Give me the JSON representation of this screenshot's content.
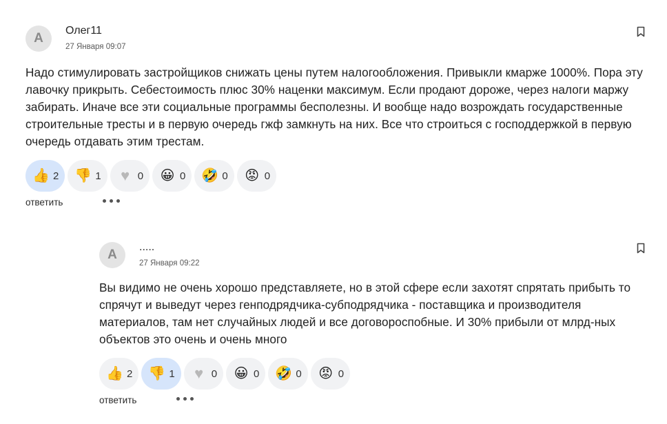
{
  "comments": [
    {
      "avatar_letter": "A",
      "author": "Олег11",
      "date": "27 Января 09:07",
      "text": "Надо стимулировать застройщиков снижать цены путем налогообложения. Привыкли кмарже 1000%. Пора эту лавочку прикрыть. Себестоимость плюс 30% наценки максимум. Если продают дороже, через налоги маржу забирать. Иначе все эти социальные программы бесполезны. И вообще надо возрождать государственные строительные тресты и в первую очередь гжф замкнуть на них. Все что строиться с господдержкой в первую очередь отдавать этим трестам.",
      "reactions": [
        {
          "icon": "thumbs-up-icon",
          "emoji": "👍",
          "count": "2",
          "active": true
        },
        {
          "icon": "thumbs-down-icon",
          "emoji": "👎",
          "count": "1",
          "active": false
        },
        {
          "icon": "heart-icon",
          "emoji": "♥",
          "count": "0",
          "active": false
        },
        {
          "icon": "grinning-face-icon",
          "emoji": "😀",
          "count": "0",
          "active": false
        },
        {
          "icon": "rolling-laughing-icon",
          "emoji": "🤣",
          "count": "0",
          "active": false
        },
        {
          "icon": "angry-face-icon",
          "emoji": "😡",
          "count": "0",
          "active": false
        }
      ],
      "reply_label": "ответить"
    },
    {
      "avatar_letter": "A",
      "author": ".....",
      "date": "27 Января 09:22",
      "text": "Вы видимо не очень хорошо представляете, но в этой сфере если захотят спрятать прибыть то спрячут и выведут через генподрядчика-субподрядчика - поставщика и производителя материалов, там нет случайных людей и все договороспобные. И 30% прибыли от млрд-ных объектов это очень и очень много",
      "reactions": [
        {
          "icon": "thumbs-up-icon",
          "emoji": "👍",
          "count": "2",
          "active": false
        },
        {
          "icon": "thumbs-down-icon",
          "emoji": "👎",
          "count": "1",
          "active": true
        },
        {
          "icon": "heart-icon",
          "emoji": "♥",
          "count": "0",
          "active": false
        },
        {
          "icon": "grinning-face-icon",
          "emoji": "😀",
          "count": "0",
          "active": false
        },
        {
          "icon": "rolling-laughing-icon",
          "emoji": "🤣",
          "count": "0",
          "active": false
        },
        {
          "icon": "angry-face-icon",
          "emoji": "😡",
          "count": "0",
          "active": false
        }
      ],
      "reply_label": "ответить"
    }
  ],
  "colors": {
    "reaction_bg": "#f1f2f4",
    "reaction_active_bg": "#d6e5fb",
    "avatar_bg": "#e4e4e4",
    "heart": "#b8b8b8"
  }
}
